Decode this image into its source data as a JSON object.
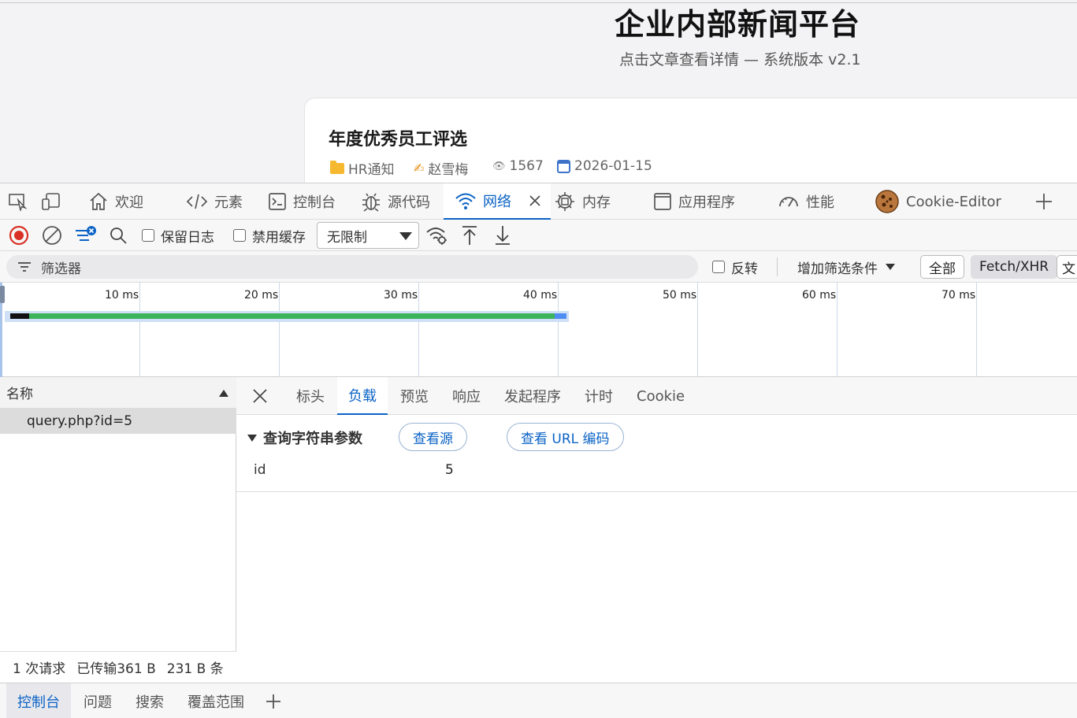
{
  "page": {
    "title": "企业内部新闻平台",
    "subtitle": "点击文章查看详情 — 系统版本 v2.1",
    "article": {
      "title": "年度优秀员工评选",
      "category": "HR通知",
      "author": "赵雪梅",
      "views": "1567",
      "date": "2026-01-15"
    }
  },
  "devtools": {
    "main_tabs": [
      {
        "label": "欢迎",
        "icon": "home-icon"
      },
      {
        "label": "元素",
        "icon": "code-icon"
      },
      {
        "label": "控制台",
        "icon": "console-icon"
      },
      {
        "label": "源代码",
        "icon": "bug-icon"
      },
      {
        "label": "网络",
        "icon": "wifi-icon",
        "active": true
      },
      {
        "label": "内存",
        "icon": "chip-icon"
      },
      {
        "label": "应用程序",
        "icon": "window-icon"
      },
      {
        "label": "性能",
        "icon": "gauge-icon"
      },
      {
        "label": "Cookie-Editor",
        "icon": "cookie-icon"
      }
    ],
    "toolbar": {
      "preserve_log": "保留日志",
      "disable_cache": "禁用缓存",
      "throttle": "无限制"
    },
    "filter": {
      "placeholder": "筛选器",
      "invert": "反转",
      "more_filters": "增加筛选条件",
      "all": "全部",
      "fetch_xhr": "Fetch/XHR",
      "doc": "文"
    },
    "timeline": {
      "ticks": [
        "10 ms",
        "20 ms",
        "30 ms",
        "40 ms",
        "50 ms",
        "60 ms",
        "70 ms"
      ]
    },
    "requests": {
      "header": "名称",
      "items": [
        "query.php?id=5"
      ],
      "status": {
        "count": "1 次请求",
        "transferred": "已传输361 B",
        "resources": "231 B 条"
      }
    },
    "detail": {
      "tabs": [
        "标头",
        "负载",
        "预览",
        "响应",
        "发起程序",
        "计时",
        "Cookie"
      ],
      "active_tab": "负载",
      "section_title": "查询字符串参数",
      "view_source": "查看源",
      "view_url_encoded": "查看 URL 编码",
      "params": [
        {
          "key": "id",
          "value": "5"
        }
      ]
    },
    "drawer": {
      "tabs": [
        "控制台",
        "问题",
        "搜索",
        "覆盖范围"
      ],
      "active_tab": "控制台"
    },
    "colors": {
      "accent": "#0b63c5",
      "record": "#d93025",
      "timeline_green": "#3cb45c",
      "timeline_blue": "#4e8ef2"
    }
  }
}
